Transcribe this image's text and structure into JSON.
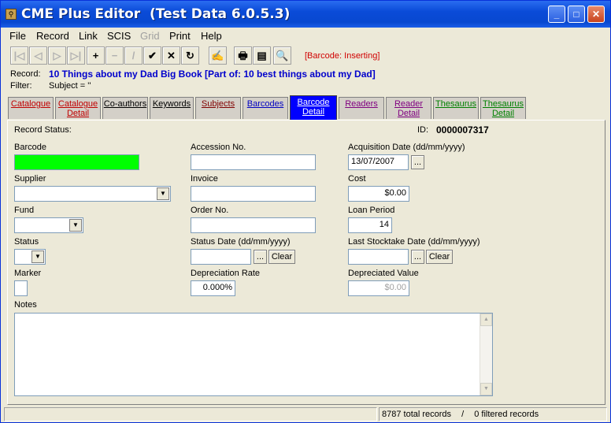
{
  "window": {
    "title": "CME Plus Editor  (Test Data 6.0.5.3)"
  },
  "menu": [
    {
      "label": "File",
      "enabled": true
    },
    {
      "label": "Record",
      "enabled": true
    },
    {
      "label": "Link",
      "enabled": true
    },
    {
      "label": "SCIS",
      "enabled": true
    },
    {
      "label": "Grid",
      "enabled": false
    },
    {
      "label": "Print",
      "enabled": true
    },
    {
      "label": "Help",
      "enabled": true
    }
  ],
  "toolbar": {
    "buttons": [
      {
        "name": "first-record",
        "glyph": "|◁",
        "enabled": false
      },
      {
        "name": "previous-record",
        "glyph": "◁",
        "enabled": false
      },
      {
        "name": "next-record",
        "glyph": "▷",
        "enabled": false
      },
      {
        "name": "last-record",
        "glyph": "▷|",
        "enabled": false
      },
      {
        "name": "add-record",
        "glyph": "+",
        "enabled": true
      },
      {
        "name": "delete-record",
        "glyph": "−",
        "enabled": false
      },
      {
        "name": "edit-record",
        "glyph": "/",
        "enabled": false
      },
      {
        "name": "post-record",
        "glyph": "✔",
        "enabled": true
      },
      {
        "name": "cancel-edit",
        "glyph": "✕",
        "enabled": true
      },
      {
        "name": "refresh",
        "glyph": "↻",
        "enabled": true
      },
      {
        "name": "wizard",
        "glyph": "✍",
        "enabled": false
      },
      {
        "name": "print",
        "glyph": "🖶",
        "enabled": true
      },
      {
        "name": "print-preview",
        "glyph": "▤",
        "enabled": true
      },
      {
        "name": "find",
        "glyph": "🔍",
        "enabled": true
      }
    ],
    "status": "[Barcode: Inserting]"
  },
  "record": {
    "label": "Record:",
    "title": "10 Things about my Dad Big Book [Part of: 10 best things about my Dad]"
  },
  "filter": {
    "label": "Filter:",
    "value": "Subject = ''"
  },
  "tabs": [
    {
      "l1": "Catalogue",
      "l2": "",
      "color": "#c00000",
      "active": false
    },
    {
      "l1": "Catalogue",
      "l2": "Detail",
      "color": "#c00000",
      "active": false
    },
    {
      "l1": "Co-authors",
      "l2": "",
      "color": "#000000",
      "active": false
    },
    {
      "l1": "Keywords",
      "l2": "",
      "color": "#000000",
      "active": false
    },
    {
      "l1": "Subjects",
      "l2": "",
      "color": "#800000",
      "active": false
    },
    {
      "l1": "Barcodes",
      "l2": "",
      "color": "#0000c0",
      "active": false
    },
    {
      "l1": "Barcode",
      "l2": "Detail",
      "color": "#ffffff",
      "active": true
    },
    {
      "l1": "Readers",
      "l2": "",
      "color": "#800080",
      "active": false
    },
    {
      "l1": "Reader",
      "l2": "Detail",
      "color": "#800080",
      "active": false
    },
    {
      "l1": "Thesaurus",
      "l2": "",
      "color": "#008000",
      "active": false
    },
    {
      "l1": "Thesaurus",
      "l2": "Detail",
      "color": "#008000",
      "active": false
    }
  ],
  "form": {
    "record_status_label": "Record Status:",
    "id_label": "ID:",
    "id_value": "0000007317",
    "barcode": {
      "label": "Barcode",
      "value": ""
    },
    "accession_no": {
      "label": "Accession No.",
      "value": ""
    },
    "acquisition_date": {
      "label": "Acquisition Date (dd/mm/yyyy)",
      "value": "13/07/2007"
    },
    "supplier": {
      "label": "Supplier",
      "value": ""
    },
    "invoice": {
      "label": "Invoice",
      "value": ""
    },
    "cost": {
      "label": "Cost",
      "value": "$0.00"
    },
    "fund": {
      "label": "Fund",
      "value": ""
    },
    "order_no": {
      "label": "Order No.",
      "value": ""
    },
    "loan_period": {
      "label": "Loan Period",
      "value": "14"
    },
    "status": {
      "label": "Status",
      "value": ""
    },
    "status_date": {
      "label": "Status Date (dd/mm/yyyy)",
      "value": ""
    },
    "last_stocktake_date": {
      "label": "Last Stocktake Date (dd/mm/yyyy)",
      "value": ""
    },
    "marker": {
      "label": "Marker",
      "value": ""
    },
    "depreciation_rate": {
      "label": "Depreciation Rate",
      "value": "0.000%"
    },
    "depreciated_value": {
      "label": "Depreciated Value",
      "value": "$0.00"
    },
    "notes": {
      "label": "Notes",
      "value": ""
    },
    "ellipsis": "...",
    "clear_label": "Clear"
  },
  "statusbar": {
    "total": "8787 total records",
    "separator": "/",
    "filtered": "0 filtered records"
  },
  "colors": {
    "barcode_field": "#00ff00",
    "active_tab": "#0000ff",
    "record_title": "#0000cc",
    "status_red": "#d00000"
  }
}
